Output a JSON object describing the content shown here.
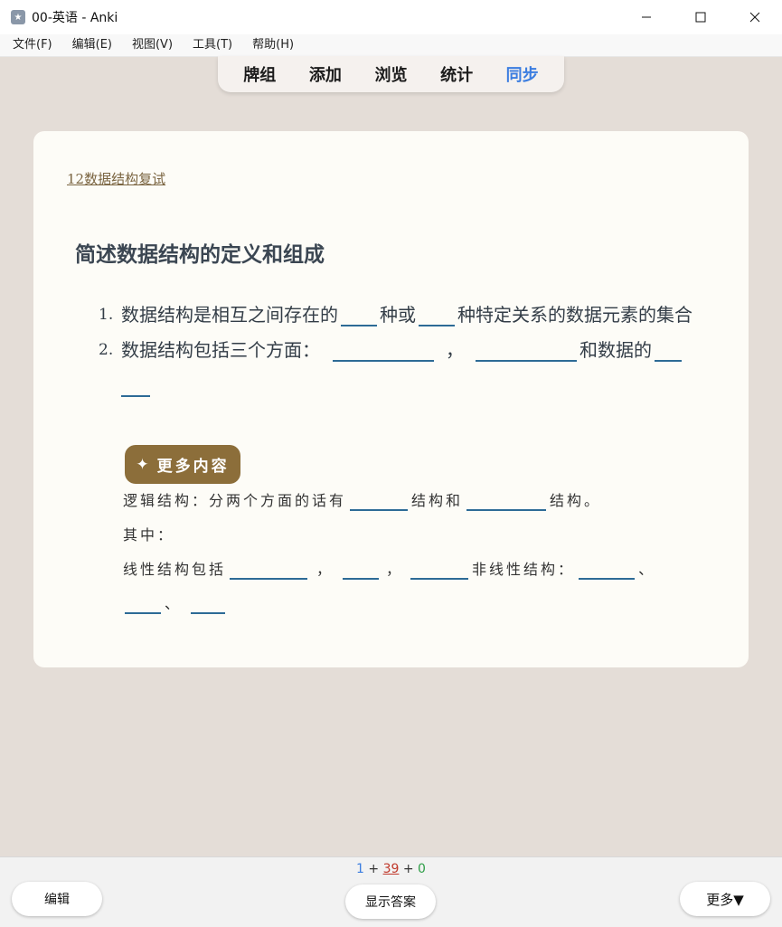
{
  "window": {
    "title": "00-英语 - Anki",
    "icon": "anki-star-icon"
  },
  "menu": {
    "items": [
      "文件(F)",
      "编辑(E)",
      "视图(V)",
      "工具(T)",
      "帮助(H)"
    ]
  },
  "toolbar": {
    "links": [
      "牌组",
      "添加",
      "浏览",
      "统计",
      "同步"
    ],
    "active_color": "#3b7de0"
  },
  "card": {
    "deck_link": "12数据结构复试",
    "title": "简述数据结构的定义和组成",
    "list": {
      "item1_num": "1.",
      "item1_a": "数据结构是相互之间存在的",
      "item1_b": "种或",
      "item1_c": "种特定关系的数据元素的集合",
      "item2_num": "2.",
      "item2_a": "数据结构包括三个方面：",
      "item2_b": "，",
      "item2_c": "和数据的"
    },
    "more_button": "更多内容",
    "more": {
      "line1_a": "逻辑结构：分两个方面的话有",
      "line1_b": "结构和",
      "line1_c": "结构。",
      "line2": "其中：",
      "line3_a": "线性结构包括",
      "line3_b": "，",
      "line3_c": "，",
      "line3_d": "非线性结构：",
      "line3_e": "、",
      "line4_a": "、"
    }
  },
  "bottom": {
    "counts": {
      "new": "1",
      "plus1": "+",
      "learn": "39",
      "plus2": "+",
      "review": "0"
    },
    "edit_button": "编辑",
    "show_answer_button": "显示答案",
    "more_button": "更多▼"
  },
  "colors": {
    "background": "#e4ddd7",
    "card": "#fdfcf7",
    "more_button": "#8c6e3a",
    "blank_line": "#2d6b96"
  }
}
